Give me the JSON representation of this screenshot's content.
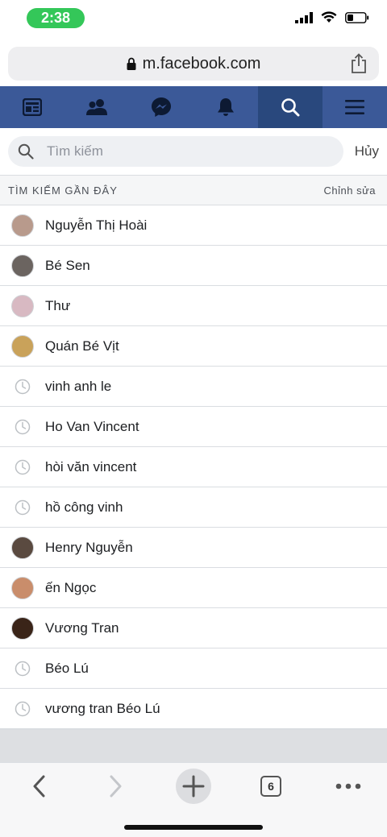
{
  "status_bar": {
    "time": "2:38",
    "time_pill_color": "#34c759"
  },
  "browser": {
    "url": "m.facebook.com"
  },
  "nav": {
    "color": "#3b5998",
    "items": [
      {
        "name": "news-feed-icon",
        "active": false
      },
      {
        "name": "friends-icon",
        "active": false
      },
      {
        "name": "messenger-icon",
        "active": false
      },
      {
        "name": "notifications-icon",
        "active": false
      },
      {
        "name": "search-icon",
        "active": true
      },
      {
        "name": "menu-icon",
        "active": false
      }
    ]
  },
  "search": {
    "placeholder": "Tìm kiếm",
    "value": "",
    "cancel_label": "Hủy"
  },
  "recent": {
    "header": "TÌM KIẾM GẦN ĐÂY",
    "edit_label": "Chỉnh sửa",
    "items": [
      {
        "label": "Nguyễn Thị Hoài",
        "kind": "avatar",
        "color": "#b89a8c"
      },
      {
        "label": "Bé Sen",
        "kind": "avatar",
        "color": "#6b6460"
      },
      {
        "label": "Thư",
        "kind": "avatar",
        "color": "#d8b9c2"
      },
      {
        "label": "Quán Bé Vịt",
        "kind": "avatar",
        "color": "#c9a25a"
      },
      {
        "label": "vinh anh le",
        "kind": "history"
      },
      {
        "label": "Ho Van Vincent",
        "kind": "history"
      },
      {
        "label": "hòi văn vincent",
        "kind": "history"
      },
      {
        "label": "hồ công vinh",
        "kind": "history"
      },
      {
        "label": "Henry Nguyễn",
        "kind": "avatar",
        "color": "#5a4a40"
      },
      {
        "label": "ến Ngọc",
        "kind": "avatar",
        "color": "#c98d6b"
      },
      {
        "label": "Vương Tran",
        "kind": "avatar",
        "color": "#3a2418"
      },
      {
        "label": "Béo Lú",
        "kind": "history"
      },
      {
        "label": "vương tran Béo Lú",
        "kind": "history"
      }
    ]
  },
  "toolbar": {
    "tab_count": "6"
  }
}
